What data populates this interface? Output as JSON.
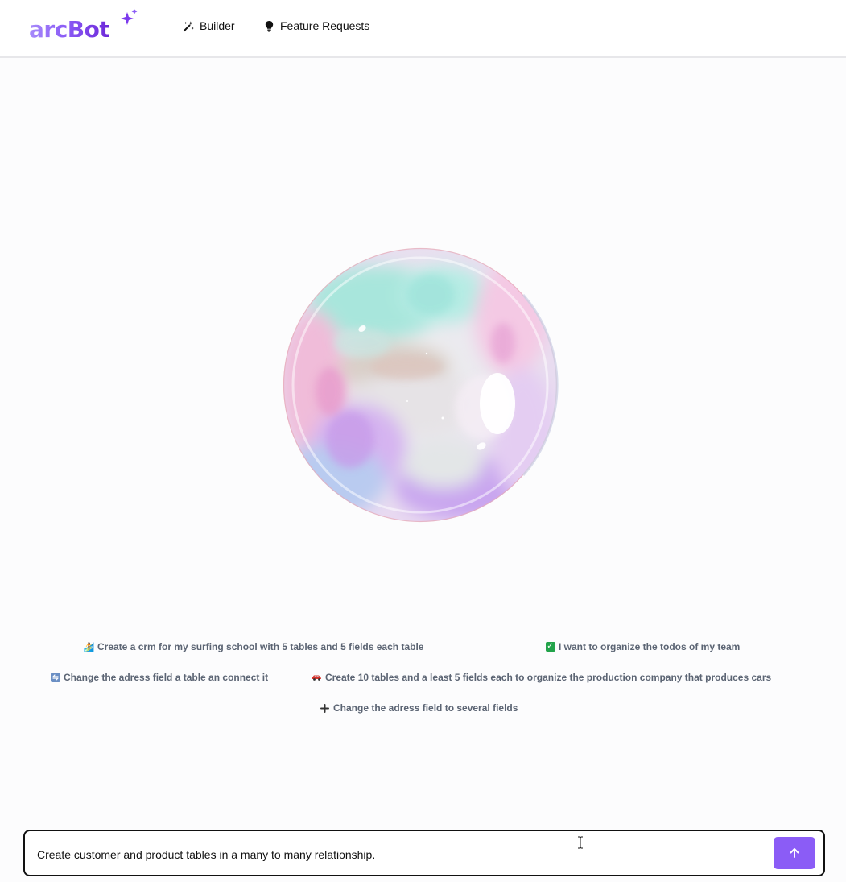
{
  "app": {
    "logo_text": "arcBot"
  },
  "nav": {
    "builder": {
      "label": "Builder",
      "icon": "magic-wand-icon"
    },
    "feature_requests": {
      "label": "Feature Requests",
      "icon": "lightbulb-icon"
    }
  },
  "suggestions": [
    {
      "emoji": "🏄",
      "label": "Create a crm for my surfing school with 5 tables and 5 fields each table"
    },
    {
      "emoji": "✅",
      "label": "I want to organize the todos of my team"
    },
    {
      "emoji": "↩️",
      "label": "Change the adress field a table an connect it"
    },
    {
      "emoji": "🚗",
      "label": "Create 10 tables and a least 5 fields each to organize the production company that produces cars"
    },
    {
      "emoji": "➕",
      "label": "Change the adress field to several fields"
    }
  ],
  "chat_input": {
    "value": "Create customer and product tables in a many to many relationship.",
    "send_icon": "arrow-up-icon"
  },
  "colors": {
    "accent": "#8b5cf6",
    "suggestion_text": "#5b6473"
  }
}
